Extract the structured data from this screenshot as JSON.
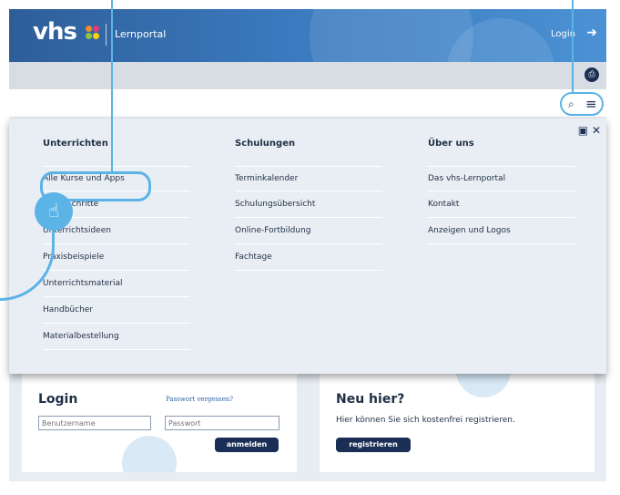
{
  "header": {
    "logo_text": "vhs",
    "portal_label": "Lernportal",
    "login_label": "Login",
    "login_icon": "sign-in-icon"
  },
  "toolbar": {
    "print_icon": "print-icon",
    "search_icon": "search-icon",
    "menu_icon": "hamburger-menu-icon"
  },
  "menu": {
    "tools_icon_1": "screen-share-icon",
    "tools_icon_2": "close-icon",
    "columns": [
      {
        "heading": "Unterrichten",
        "items": [
          "Alle Kurse und Apps",
          "Erste Schritte",
          "Unterrichtsideen",
          "Praxisbeispiele",
          "Unterrichtsmaterial",
          "Handbücher",
          "Materialbestellung"
        ]
      },
      {
        "heading": "Schulungen",
        "items": [
          "Terminkalender",
          "Schulungsübersicht",
          "Online-Fortbildung",
          "Fachtage"
        ]
      },
      {
        "heading": "Über uns",
        "items": [
          "Das vhs-Lernportal",
          "Kontakt",
          "Anzeigen und Logos"
        ]
      }
    ]
  },
  "login_box": {
    "title": "Login",
    "forgot_link": "Passwort vergessen?",
    "username_placeholder": "Benutzername",
    "password_placeholder": "Passwort",
    "submit_label": "anmelden"
  },
  "register_box": {
    "title": "Neu hier?",
    "text": "Hier können Sie sich kostenfrei registrieren.",
    "button_label": "registrieren"
  },
  "colors": {
    "header_blue": "#3a79bd",
    "navy": "#1b2e55",
    "highlight": "#5bb3e6"
  }
}
